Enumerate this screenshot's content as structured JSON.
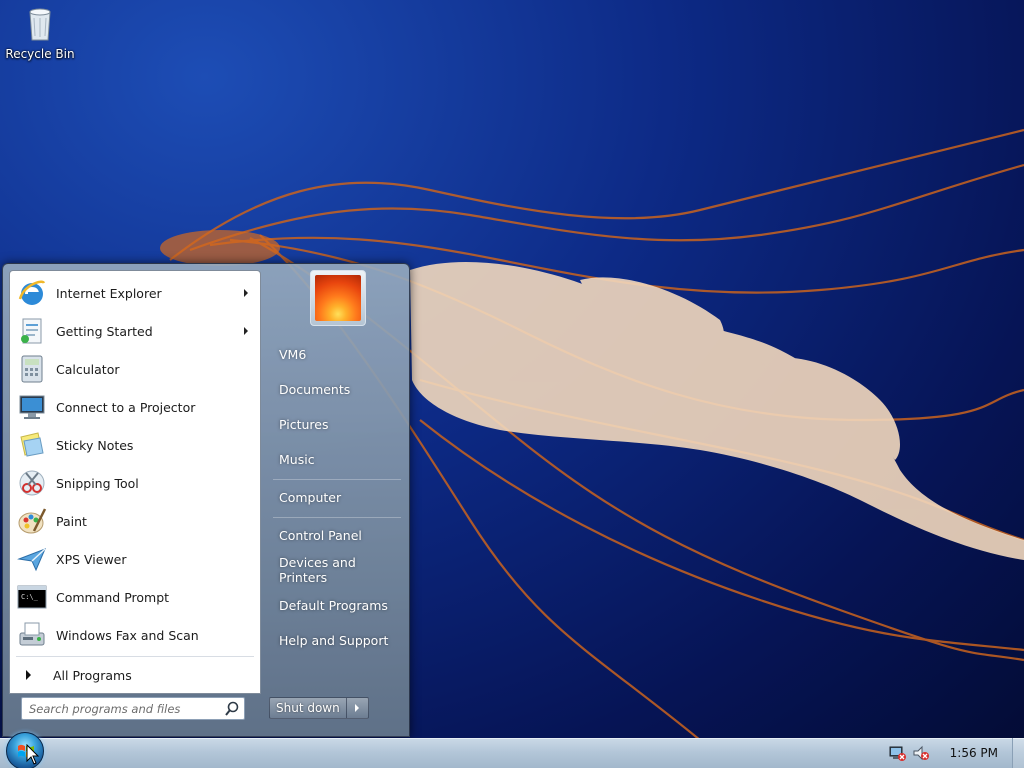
{
  "desktop": {
    "icons": [
      {
        "label": "Recycle Bin",
        "icon": "recycle-bin-icon"
      }
    ]
  },
  "start_menu": {
    "programs": [
      {
        "label": "Internet Explorer",
        "icon": "internet-explorer-icon",
        "has_submenu": true
      },
      {
        "label": "Getting Started",
        "icon": "getting-started-icon",
        "has_submenu": true
      },
      {
        "label": "Calculator",
        "icon": "calculator-icon",
        "has_submenu": false
      },
      {
        "label": "Connect to a Projector",
        "icon": "projector-icon",
        "has_submenu": false
      },
      {
        "label": "Sticky Notes",
        "icon": "sticky-notes-icon",
        "has_submenu": false
      },
      {
        "label": "Snipping Tool",
        "icon": "snipping-tool-icon",
        "has_submenu": false
      },
      {
        "label": "Paint",
        "icon": "paint-icon",
        "has_submenu": false
      },
      {
        "label": "XPS Viewer",
        "icon": "xps-viewer-icon",
        "has_submenu": false
      },
      {
        "label": "Command Prompt",
        "icon": "command-prompt-icon",
        "has_submenu": false
      },
      {
        "label": "Windows Fax and Scan",
        "icon": "fax-scan-icon",
        "has_submenu": false
      }
    ],
    "all_programs_label": "All Programs",
    "search_placeholder": "Search programs and files",
    "right_items": [
      {
        "label": "VM6"
      },
      {
        "label": "Documents"
      },
      {
        "label": "Pictures"
      },
      {
        "label": "Music"
      },
      {
        "label": "Computer"
      },
      {
        "label": "Control Panel"
      },
      {
        "label": "Devices and Printers"
      },
      {
        "label": "Default Programs"
      },
      {
        "label": "Help and Support"
      }
    ],
    "shutdown_label": "Shut down"
  },
  "taskbar": {
    "clock": "1:56 PM",
    "tray_icons": [
      "network-icon",
      "volume-muted-icon"
    ]
  },
  "colors": {
    "menu_right_text": "#ffffff",
    "desktop_blue": "#0d2a86"
  }
}
